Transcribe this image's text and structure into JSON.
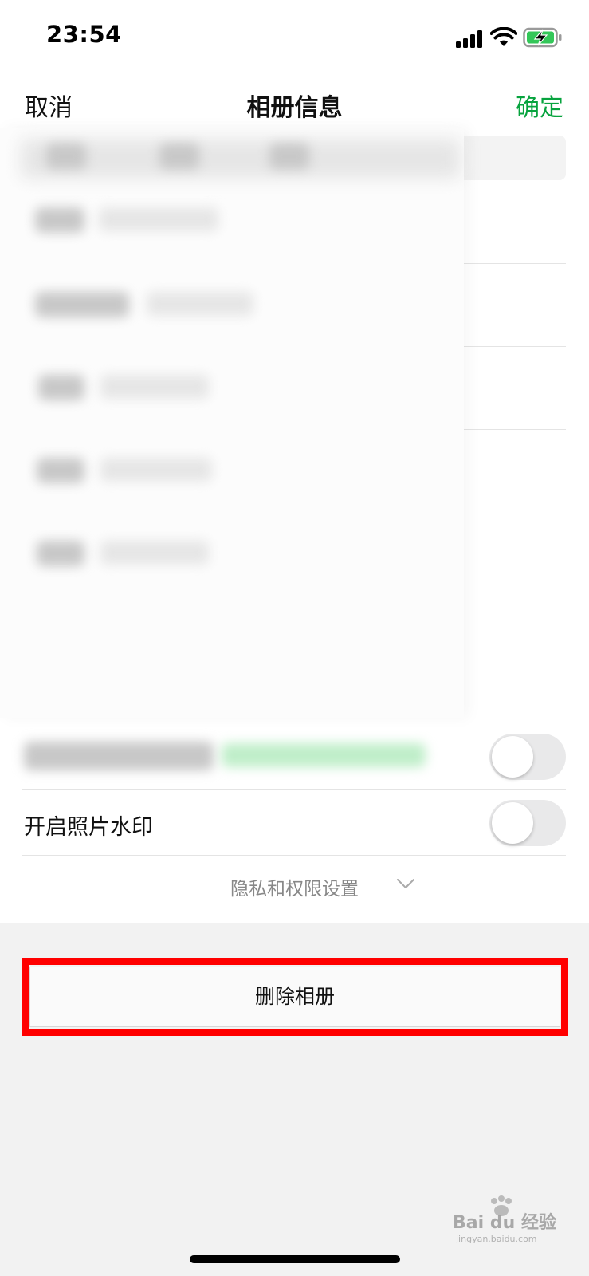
{
  "status": {
    "time": "23:54"
  },
  "nav": {
    "cancel_label": "取消",
    "title": "相册信息",
    "confirm_label": "确定",
    "confirm_color": "#07a33e"
  },
  "settings": {
    "watermark_label": "开启照片水印",
    "watermark_on": false,
    "privacy_label": "隐私和权限设置"
  },
  "actions": {
    "delete_label": "删除相册"
  },
  "watermark": {
    "brand": "Bai du 经验",
    "url": "jingyan.baidu.com"
  },
  "colors": {
    "highlight": "#ff0000",
    "background": "#f2f2f2"
  }
}
